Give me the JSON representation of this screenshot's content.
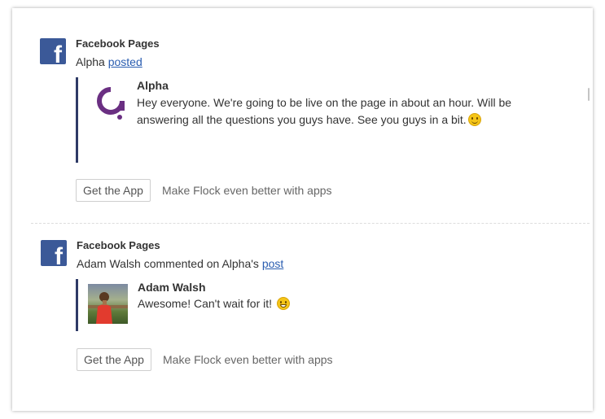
{
  "messages": [
    {
      "app_name": "Facebook Pages",
      "action_prefix": "Alpha ",
      "action_link": "posted",
      "author": "Alpha",
      "text": "Hey everyone. We're going to be live on the page in about an hour. Will be answering all the questions you guys have. See you guys in a bit.",
      "emoji": "slight-smile-emoji",
      "button": "Get the App",
      "hint": "Make Flock even better with apps"
    },
    {
      "app_name": "Facebook Pages",
      "action_prefix": "Adam Walsh commented on Alpha's ",
      "action_link": "post",
      "author": "Adam Walsh",
      "text": "Awesome! Can't wait for it!",
      "emoji": "grin-emoji",
      "button": "Get the App",
      "hint": "Make Flock even better with apps"
    }
  ],
  "colors": {
    "facebook_blue": "#3b5998",
    "link": "#2a5db0",
    "quote_bar": "#2e3a66",
    "alpha_logo": "#6a2f82"
  },
  "icons": {
    "facebook": "facebook-icon",
    "alpha_logo": "alpha-logo-icon",
    "avatar": "avatar"
  }
}
